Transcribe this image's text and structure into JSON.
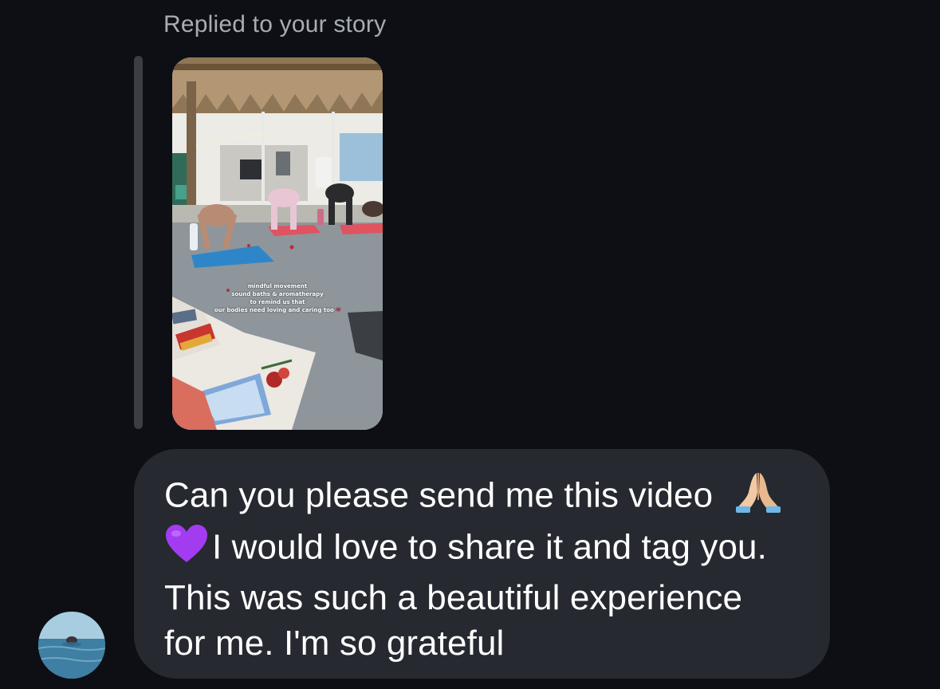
{
  "reply": {
    "label": "Replied to your story"
  },
  "story": {
    "caption_lines": [
      "mindful movement",
      "sound baths & aromatherapy",
      "to remind us that",
      "our bodies need loving and caring too"
    ],
    "caption_emoji": "heart-icon"
  },
  "message": {
    "lines": [
      "Can you please send me this video",
      "I would love to share it and tag you.",
      "This was such a beautiful experience",
      "for me. I'm so grateful"
    ],
    "emojis": [
      "folded-hands-icon",
      "purple-heart-icon"
    ]
  },
  "colors": {
    "background": "#0d0f14",
    "bubble": "#262930",
    "reply_bar": "#3a3d44",
    "muted_text": "#a8acb3",
    "purple_heart": "#a33cf0",
    "text": "#ffffff"
  }
}
